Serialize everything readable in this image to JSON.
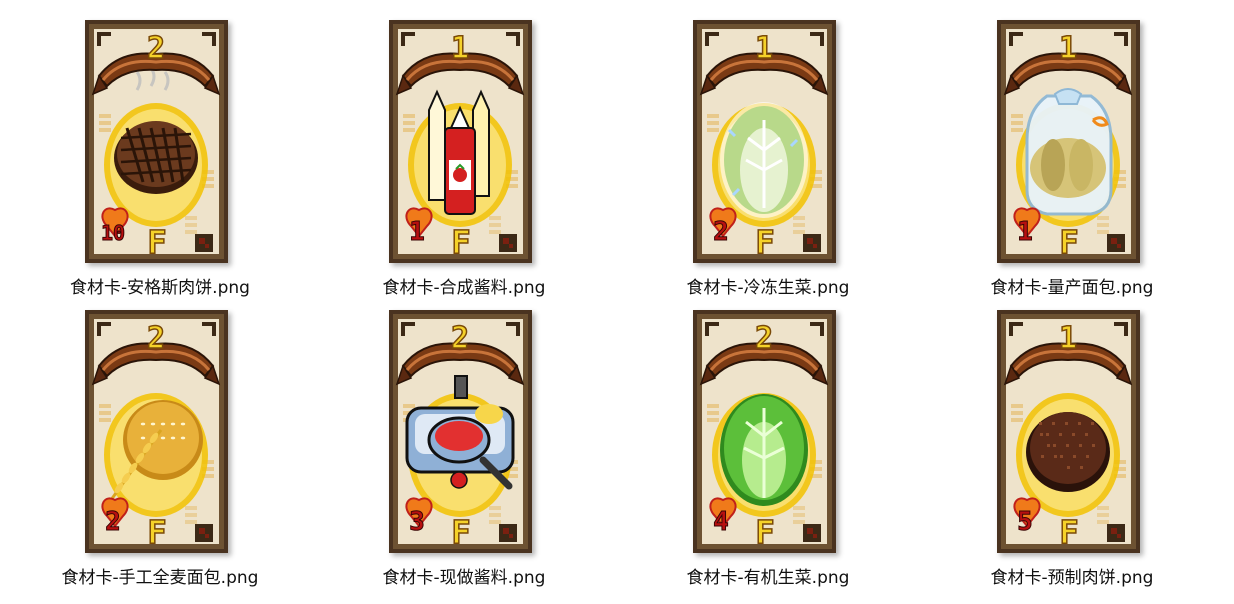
{
  "files": [
    {
      "filename": "食材卡-安格斯肉饼.png",
      "cost": "2",
      "power": "10",
      "grade": "F",
      "art_icon": "grilled-patty-icon",
      "art_main_color": "#6b3a1e",
      "art_glow_color": "#f2c200"
    },
    {
      "filename": "食材卡-合成酱料.png",
      "cost": "1",
      "power": "1",
      "grade": "F",
      "art_icon": "sauce-bottles-icon",
      "art_main_color": "#d42020",
      "art_glow_color": "#f2c200"
    },
    {
      "filename": "食材卡-冷冻生菜.png",
      "cost": "1",
      "power": "2",
      "grade": "F",
      "art_icon": "frozen-lettuce-icon",
      "art_main_color": "#b8d98a",
      "art_glow_color": "#f2c200"
    },
    {
      "filename": "食材卡-量产面包.png",
      "cost": "1",
      "power": "1",
      "grade": "F",
      "art_icon": "bagged-bread-icon",
      "art_main_color": "#d6c478",
      "art_glow_color": "#f2c200"
    },
    {
      "filename": "食材卡-手工全麦面包.png",
      "cost": "2",
      "power": "2",
      "grade": "F",
      "art_icon": "wheat-bun-icon",
      "art_main_color": "#e8b13a",
      "art_glow_color": "#f2c200"
    },
    {
      "filename": "食材卡-现做酱料.png",
      "cost": "2",
      "power": "3",
      "grade": "F",
      "art_icon": "sauce-pan-icon",
      "art_main_color": "#8fb0d6",
      "art_glow_color": "#f2c200"
    },
    {
      "filename": "食材卡-有机生菜.png",
      "cost": "2",
      "power": "4",
      "grade": "F",
      "art_icon": "fresh-lettuce-icon",
      "art_main_color": "#5cbf3a",
      "art_glow_color": "#f2c200"
    },
    {
      "filename": "食材卡-预制肉饼.png",
      "cost": "1",
      "power": "5",
      "grade": "F",
      "art_icon": "processed-patty-icon",
      "art_main_color": "#5a2a18",
      "art_glow_color": "#f2c200"
    }
  ]
}
